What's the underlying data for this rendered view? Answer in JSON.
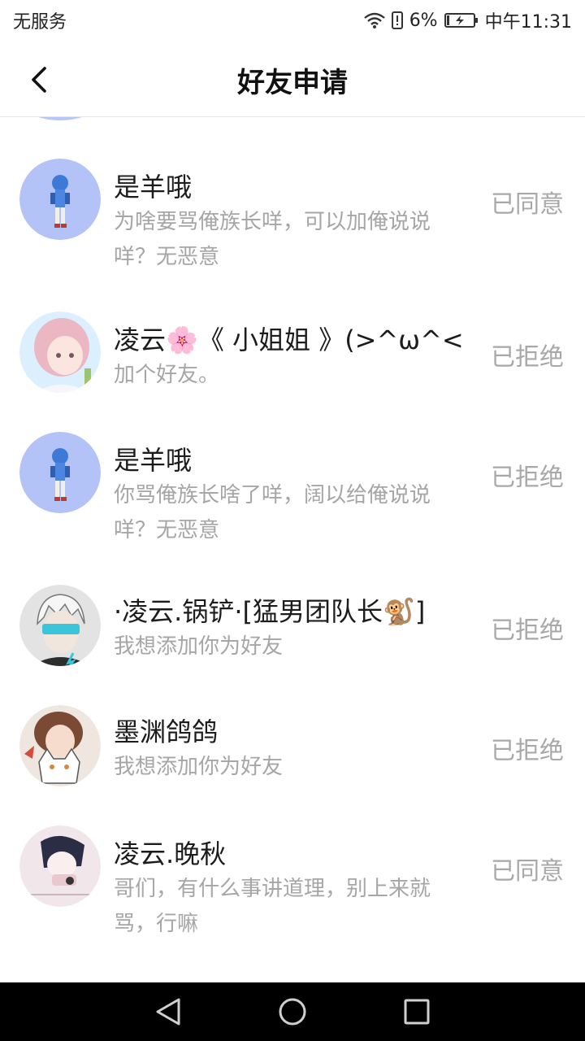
{
  "status_bar": {
    "carrier": "无服务",
    "battery": "6%",
    "time": "中午11:31"
  },
  "header": {
    "title": "好友申请"
  },
  "requests": [
    {
      "name": "是羊哦",
      "message": "为啥要骂俺族长咩，可以加俺说说咩？无恶意",
      "status": "已同意",
      "avatar": "anime-blue-hair-avatar"
    },
    {
      "name": "凌云🌸《 小姐姐 》(>^ω^<",
      "message": "加个好友。",
      "status": "已拒绝",
      "avatar": "anime-pink-hair-avatar"
    },
    {
      "name": "是羊哦",
      "message": "你骂俺族长啥了咩，阔以给俺说说咩？无恶意",
      "status": "已拒绝",
      "avatar": "anime-blue-hair-avatar"
    },
    {
      "name": "·凌云.锅铲·[猛男团队长🐒]",
      "message": "我想添加你为好友",
      "status": "已拒绝",
      "avatar": "cyber-visor-avatar"
    },
    {
      "name": "墨渊鸽鸽",
      "message": "我想添加你为好友",
      "status": "已拒绝",
      "avatar": "anime-brown-hair-cat-avatar"
    },
    {
      "name": "凌云.晚秋",
      "message": "哥们，有什么事讲道理，别上来就骂，行嘛",
      "status": "已同意",
      "avatar": "klasse14-avatar"
    }
  ],
  "colors": {
    "status_text": "#a8a8a8",
    "message_text": "#a6a6a6",
    "nav_bar": "#000000"
  }
}
